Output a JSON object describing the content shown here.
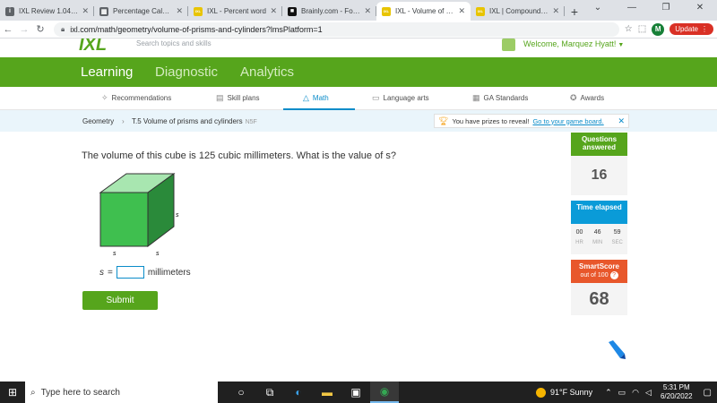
{
  "browser": {
    "tabs": [
      {
        "title": "IXL Review 1.04 (Al",
        "favicon": "i",
        "color": "#5f6368"
      },
      {
        "title": "Percentage Calcula",
        "favicon": "▦",
        "color": "#5f6368"
      },
      {
        "title": "IXL - Percent word",
        "favicon": "IXL",
        "color": "#e8c400"
      },
      {
        "title": "Brainly.com - For st",
        "favicon": "■",
        "color": "#111111"
      },
      {
        "title": "IXL - Volume of pris",
        "favicon": "IXL",
        "color": "#e8c400",
        "active": true
      },
      {
        "title": "IXL | Compound int",
        "favicon": "IXL",
        "color": "#e8c400"
      }
    ],
    "address": "ixl.com/math/geometry/volume-of-prisms-and-cylinders?lmsPlatform=1",
    "profile_initial": "M",
    "update_label": "Update"
  },
  "ixl": {
    "logo": "IXL",
    "search_placeholder": "Search topics and skills",
    "welcome": "Welcome, Marquez Hyatt!",
    "main_nav": [
      "Learning",
      "Diagnostic",
      "Analytics"
    ],
    "sub_nav": [
      "Recommendations",
      "Skill plans",
      "Math",
      "Language arts",
      "GA Standards",
      "Awards"
    ],
    "breadcrumb": {
      "subject": "Geometry",
      "sep": "›",
      "skill": "T.5 Volume of prisms and cylinders",
      "code": "N5F"
    },
    "prize": {
      "text": "You have prizes to reveal!",
      "link": "Go to your game board."
    }
  },
  "question": {
    "prompt": "The volume of this cube is 125 cubic millimeters. What is the value of s?",
    "edge_label": "s",
    "answer_var": "s",
    "equals": "=",
    "unit": "millimeters",
    "submit_label": "Submit"
  },
  "stats": {
    "questions_label": "Questions answered",
    "questions_value": "16",
    "time_label": "Time elapsed",
    "time": [
      {
        "value": "00",
        "unit": "HR"
      },
      {
        "value": "46",
        "unit": "MIN"
      },
      {
        "value": "59",
        "unit": "SEC"
      }
    ],
    "smartscore_label": "SmartScore",
    "smartscore_sub": "out of 100",
    "smartscore_value": "68"
  },
  "taskbar": {
    "search_placeholder": "Type here to search",
    "weather": "91°F  Sunny",
    "time": "5:31 PM",
    "date": "6/20/2022"
  },
  "colors": {
    "ixl_green": "#56a51c",
    "ixl_blue": "#0a9bd8",
    "smartscore_orange": "#e8572b",
    "cube_top": "#a8e6b0",
    "cube_front": "#3fbf4f",
    "cube_side": "#2a8a3a"
  }
}
